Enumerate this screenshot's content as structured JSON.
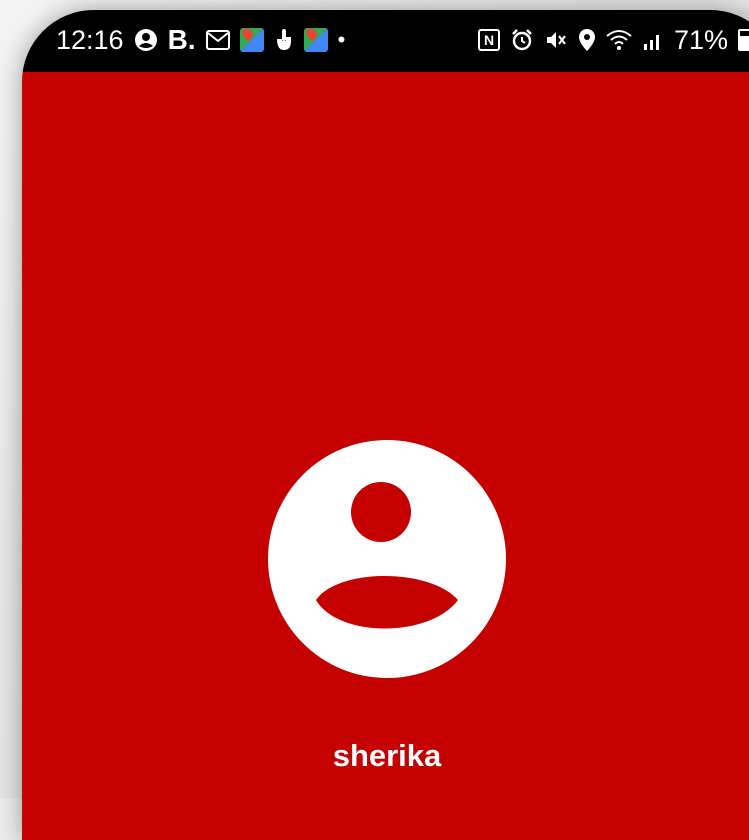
{
  "statusbar": {
    "time": "12:16",
    "left_icons": [
      "account-circle-icon",
      "booking-icon",
      "gmail-icon",
      "maps-icon",
      "tap-icon",
      "maps-icon",
      "notification-dot-icon"
    ],
    "booking_letter": "B.",
    "right_icons": [
      "nfc-icon",
      "alarm-icon",
      "mute-icon",
      "location-icon",
      "wifi-icon",
      "signal-icon",
      "battery-icon"
    ],
    "battery_percent": "71%"
  },
  "colors": {
    "background": "#c40000",
    "statusbar": "#000000",
    "foreground": "#ffffff"
  },
  "profile": {
    "avatar_icon": "account-circle-icon",
    "name": "sherika"
  }
}
